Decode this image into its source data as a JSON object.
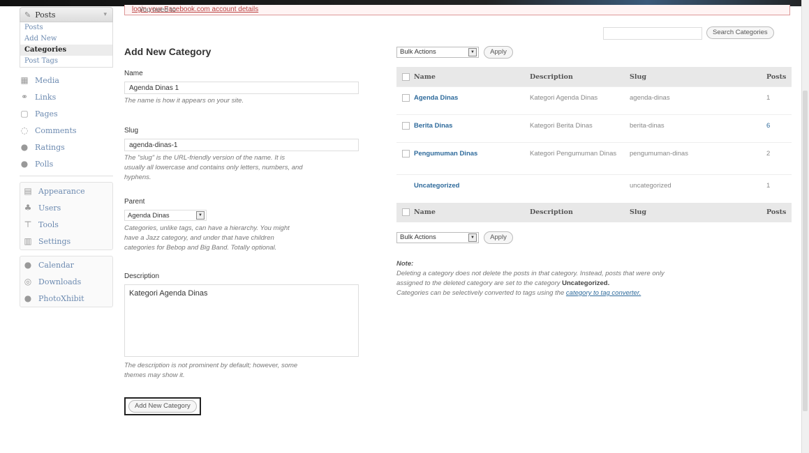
{
  "notice": {
    "text": "You need to ",
    "link": "login your Facebook.com account details"
  },
  "sidebar": {
    "posts_label": "Posts",
    "sub": [
      "Posts",
      "Add New",
      "Categories",
      "Post Tags"
    ],
    "items_a": [
      {
        "label": "Media",
        "icon": "media-icon"
      },
      {
        "label": "Links",
        "icon": "links-icon"
      },
      {
        "label": "Pages",
        "icon": "pages-icon"
      },
      {
        "label": "Comments",
        "icon": "comments-icon"
      },
      {
        "label": "Ratings",
        "icon": "ratings-icon"
      },
      {
        "label": "Polls",
        "icon": "polls-icon"
      }
    ],
    "items_b": [
      {
        "label": "Appearance",
        "icon": "appearance-icon"
      },
      {
        "label": "Users",
        "icon": "users-icon"
      },
      {
        "label": "Tools",
        "icon": "tools-icon"
      },
      {
        "label": "Settings",
        "icon": "settings-icon"
      }
    ],
    "items_c": [
      {
        "label": "Calendar",
        "icon": "calendar-icon"
      },
      {
        "label": "Downloads",
        "icon": "downloads-icon"
      },
      {
        "label": "PhotoXhibit",
        "icon": "photoxhibit-icon"
      }
    ]
  },
  "form": {
    "title": "Add New Category",
    "name_label": "Name",
    "name_value": "Agenda Dinas 1",
    "name_hint": "The name is how it appears on your site.",
    "slug_label": "Slug",
    "slug_value": "agenda-dinas-1",
    "slug_hint_1": "The \"slug\" is the URL-friendly version of the name. It is",
    "slug_hint_2": "usually all lowercase and contains only letters, numbers, and",
    "slug_hint_3": "hyphens.",
    "parent_label": "Parent",
    "parent_value": "Agenda Dinas",
    "parent_hint_1": "Categories, unlike tags, can have a hierarchy. You might",
    "parent_hint_2": "have a Jazz category, and under that have children",
    "parent_hint_3": "categories for Bebop and Big Band. Totally optional.",
    "desc_label": "Description",
    "desc_value": "Kategori Agenda Dinas",
    "desc_hint_1": "The description is not prominent by default; however, some",
    "desc_hint_2": "themes may show it.",
    "submit": "Add New Category"
  },
  "search": {
    "button": "Search Categories",
    "value": ""
  },
  "bulk": {
    "select": "Bulk Actions",
    "apply": "Apply"
  },
  "table": {
    "headers": {
      "name": "Name",
      "description": "Description",
      "slug": "Slug",
      "posts": "Posts"
    },
    "rows": [
      {
        "name": "Agenda Dinas",
        "description": "Kategori Agenda Dinas",
        "slug": "agenda-dinas",
        "posts": "1"
      },
      {
        "name": "Berita Dinas",
        "description": "Kategori Berita Dinas",
        "slug": "berita-dinas",
        "posts": "6"
      },
      {
        "name": "Pengumuman Dinas",
        "description": "Kategori Pengumuman Dinas",
        "slug": "pengumuman-dinas",
        "posts": "2"
      },
      {
        "name": "Uncategorized",
        "description": "",
        "slug": "uncategorized",
        "posts": "1"
      }
    ]
  },
  "note": {
    "title": "Note:",
    "line1": "Deleting a category does not delete the posts in that category. Instead, posts that were only",
    "line2a": "assigned to the deleted category are set to the category ",
    "line2b": "Uncategorized.",
    "line3a": "Categories can be selectively converted to tags using the ",
    "line3b": "category to tag converter."
  }
}
